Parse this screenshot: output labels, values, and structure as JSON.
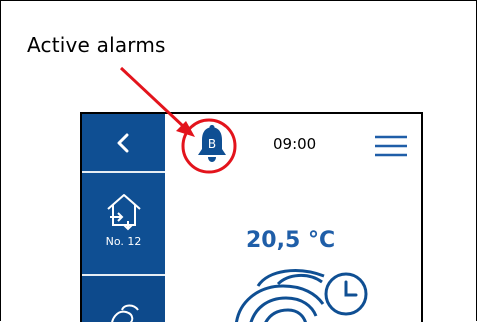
{
  "annotation": {
    "caption": "Active alarms"
  },
  "header": {
    "alarm_badge": "B",
    "time": "09:00",
    "menu_icon": "hamburger-menu-icon",
    "alarm_icon": "bell-icon"
  },
  "sidebar": {
    "back_icon": "chevron-left-icon",
    "items": [
      {
        "icon": "house-icon",
        "label": "No. 12"
      },
      {
        "icon": "fan-icon",
        "label": ""
      }
    ]
  },
  "main": {
    "temperature": "20,5 °C",
    "mode_icon": "fan-timer-icon"
  },
  "colors": {
    "brand_blue": "#0f4f93",
    "accent_blue": "#1f5ea8",
    "annotation_red": "#e3141c"
  }
}
